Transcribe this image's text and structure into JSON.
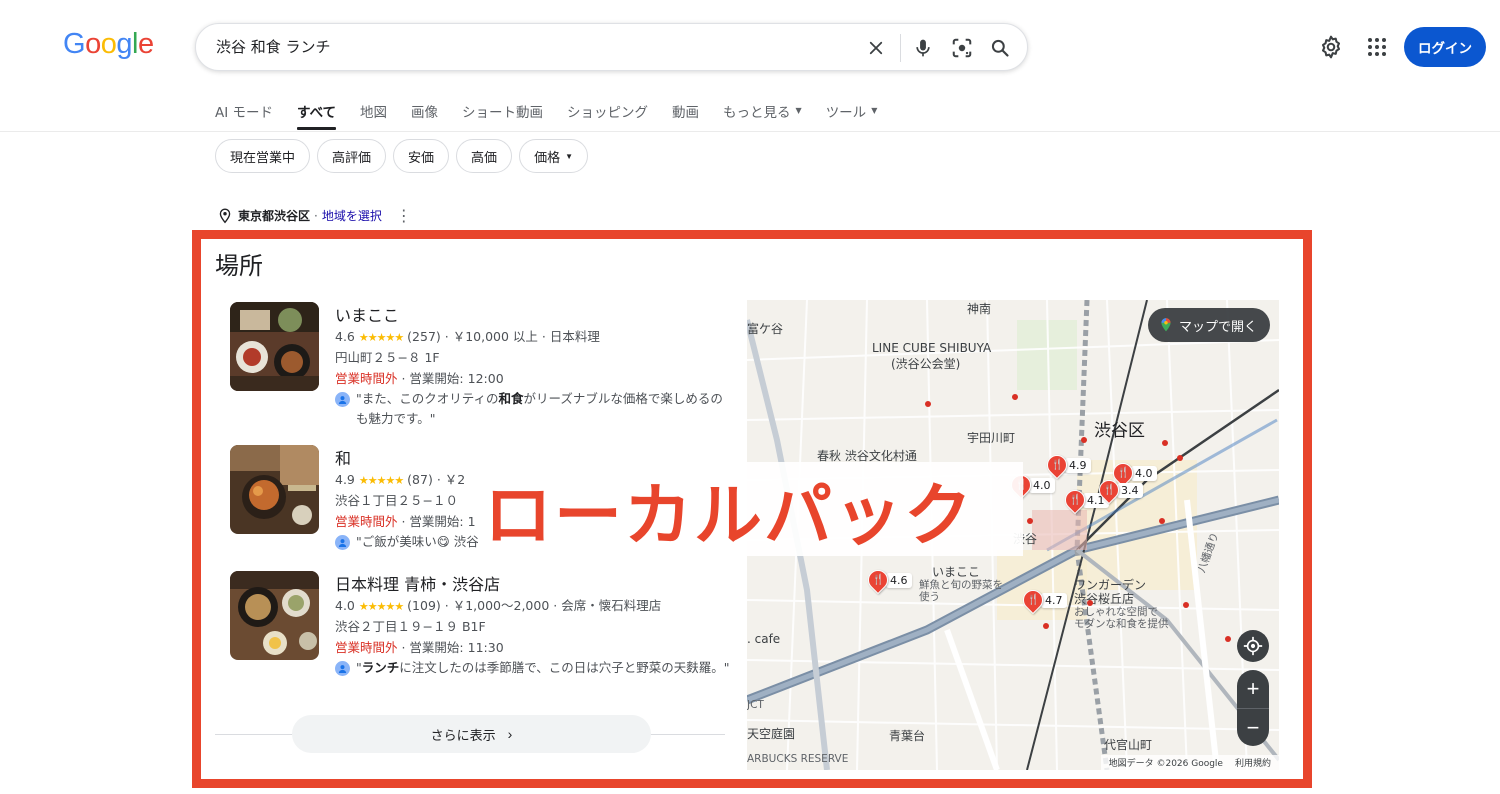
{
  "header": {
    "logo": [
      "G",
      "o",
      "o",
      "g",
      "l",
      "e"
    ],
    "logo_colors": [
      "#4285f4",
      "#ea4335",
      "#fbbc05",
      "#4285f4",
      "#34a853",
      "#ea4335"
    ],
    "query": "渋谷 和食 ランチ",
    "login_label": "ログイン",
    "accent": "#0b57d0"
  },
  "tabs": [
    {
      "label": "AI モード"
    },
    {
      "label": "すべて"
    },
    {
      "label": "地図"
    },
    {
      "label": "画像"
    },
    {
      "label": "ショート動画"
    },
    {
      "label": "ショッピング"
    },
    {
      "label": "動画"
    },
    {
      "label": "もっと見る"
    },
    {
      "label": "ツール"
    }
  ],
  "chips": [
    {
      "label": "現在営業中"
    },
    {
      "label": "高評価"
    },
    {
      "label": "安価"
    },
    {
      "label": "高価"
    },
    {
      "label": "価格"
    }
  ],
  "location": {
    "area": "東京都渋谷区",
    "separator": "·",
    "change_link": "地域を選択"
  },
  "places": {
    "title": "場所",
    "listings": [
      {
        "name": "いまここ",
        "rating": "4.6",
        "stars": "★★★★★",
        "reviews": "(257)",
        "details": " · ￥10,000 以上 · 日本料理",
        "address": "円山町２５−８ 1F",
        "status": "営業時間外",
        "hours": " · 営業開始: 12:00",
        "review_pre": "\"また、このクオリティの",
        "review_bold": "和食",
        "review_post": "がリーズナブルな価格で楽しめるのも魅力です。\""
      },
      {
        "name": "和",
        "rating": "4.9",
        "stars": "★★★★★",
        "reviews": "(87)",
        "details": " · ￥2",
        "address": "渋谷１丁目２５−１０",
        "status": "営業時間外",
        "hours": " · 営業開始: 1",
        "review_pre": "\"ご飯が美味い😋 渋谷",
        "review_bold": "",
        "review_post": ""
      },
      {
        "name": "日本料理 青柿・渋谷店",
        "rating": "4.0",
        "stars": "★★★★★",
        "reviews": "(109)",
        "details": " · ￥1,000～2,000 · 会席・懐石料理店",
        "address": "渋谷２丁目１９−１９ B1F",
        "status": "営業時間外",
        "hours": " · 営業開始: 11:30",
        "review_pre": "\"",
        "review_bold": "ランチ",
        "review_post": "に注文したのは季節膳で、この日は穴子と野菜の天麩羅。\""
      }
    ],
    "more_label": "さらに表示"
  },
  "map": {
    "open_label": "マップで開く",
    "labels": {
      "line_cube": "LINE CUBE SHIBUYA",
      "koukaido": "(渋谷公会堂)",
      "shibuya_ku": "渋谷区",
      "udagawa": "宇田川町",
      "shunju": "春秋 渋谷文化村通",
      "imakoko": "いまここ",
      "imakoko_sub1": "鮮魚と旬の野菜を",
      "imakoko_sub2": "使う",
      "wangarden": "ワンガーデン",
      "wangarden2": "渋谷桜丘店",
      "wangarden_sub1": "おしゃれな空間で",
      "wangarden_sub2": "モダンな和食を提供",
      "daikanyama": "代官山町",
      "aobadai": "青葉台",
      "cafe": ". cafe",
      "starbucks": "ARBUCKS RESERVE",
      "tomigaya": "富ケ谷",
      "jinnan": "神南",
      "shibuya": "渋谷",
      "ohashi": "天空庭園",
      "jct": "JCT",
      "hachiman": "八幡通り"
    },
    "pins": [
      {
        "rating": "4.9"
      },
      {
        "rating": "4.0"
      },
      {
        "rating": "4.0"
      },
      {
        "rating": "4.1"
      },
      {
        "rating": "3.4"
      },
      {
        "rating": "4.6"
      },
      {
        "rating": "4.7"
      }
    ],
    "attribution": "地図データ ©2026 Google",
    "terms": "利用規約"
  },
  "overlay": {
    "text": "ローカルパック",
    "color": "#e8452c"
  }
}
